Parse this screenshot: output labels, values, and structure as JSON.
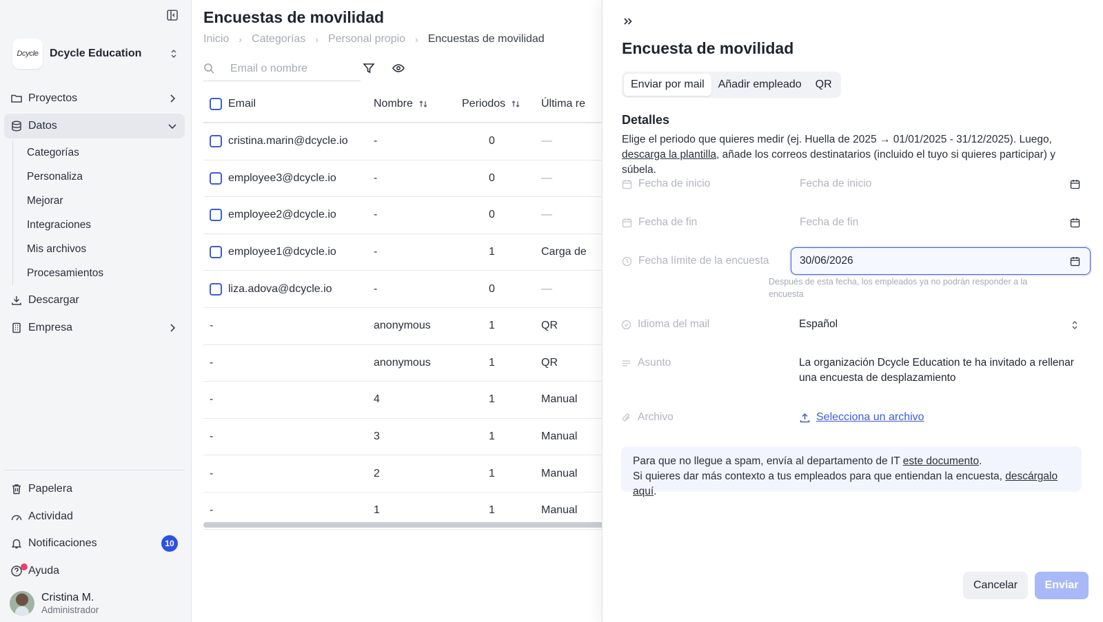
{
  "sidebar": {
    "org_logo": "Dcycle",
    "org_name": "Dcycle Education",
    "items": [
      {
        "label": "Proyectos"
      },
      {
        "label": "Datos"
      },
      {
        "label": "Descargar"
      },
      {
        "label": "Empresa"
      }
    ],
    "subitems": [
      {
        "label": "Categorías"
      },
      {
        "label": "Personaliza"
      },
      {
        "label": "Mejorar"
      },
      {
        "label": "Integraciones"
      },
      {
        "label": "Mis archivos"
      },
      {
        "label": "Procesamientos"
      }
    ],
    "bottom": [
      {
        "label": "Papelera"
      },
      {
        "label": "Actividad"
      },
      {
        "label": "Notificaciones"
      },
      {
        "label": "Ayuda"
      }
    ],
    "notifications_count": "10",
    "user": {
      "name": "Cristina M.",
      "role": "Administrador"
    }
  },
  "main": {
    "title": "Encuestas de movilidad",
    "breadcrumb": [
      "Inicio",
      "Categorías",
      "Personal propio",
      "Encuestas de movilidad"
    ],
    "search_placeholder": "Email o nombre",
    "columns": [
      "Email",
      "Nombre",
      "Periodos",
      "Última re"
    ],
    "rows": [
      {
        "email": "cristina.marin@dcycle.io",
        "name": "-",
        "periods": "0",
        "last": "—"
      },
      {
        "email": "employee3@dcycle.io",
        "name": "-",
        "periods": "0",
        "last": "—"
      },
      {
        "email": "employee2@dcycle.io",
        "name": "-",
        "periods": "0",
        "last": "—"
      },
      {
        "email": "employee1@dcycle.io",
        "name": "-",
        "periods": "1",
        "last": "Carga de"
      },
      {
        "email": "liza.adova@dcycle.io",
        "name": "-",
        "periods": "0",
        "last": "—"
      },
      {
        "email": "-",
        "name": "anonymous",
        "periods": "1",
        "last": "QR"
      },
      {
        "email": "-",
        "name": "anonymous",
        "periods": "1",
        "last": "QR"
      },
      {
        "email": "-",
        "name": "4",
        "periods": "1",
        "last": "Manual"
      },
      {
        "email": "-",
        "name": "3",
        "periods": "1",
        "last": "Manual"
      },
      {
        "email": "-",
        "name": "2",
        "periods": "1",
        "last": "Manual"
      },
      {
        "email": "-",
        "name": "1",
        "periods": "1",
        "last": "Manual"
      }
    ]
  },
  "panel": {
    "title": "Encuesta de movilidad",
    "tabs": [
      "Enviar por mail",
      "Añadir empleado",
      "QR"
    ],
    "details_heading": "Detalles",
    "details_text_1": "Elige el periodo que quieres medir (ej. Huella de 2025 → 01/01/2025 - 31/12/2025). Luego, ",
    "details_link": "descarga la plantilla",
    "details_text_2": ", añade los correos destinatarios (incluido el tuyo si quieres participar) y súbela.",
    "fields": {
      "start_label": "Fecha de inicio",
      "start_placeholder": "Fecha de inicio",
      "end_label": "Fecha de fin",
      "end_placeholder": "Fecha de fin",
      "deadline_label": "Fecha límite de la encuesta",
      "deadline_value": "30/06/2026",
      "deadline_hint": "Después de esta fecha, los empleados ya no podrán responder a la encuesta",
      "language_label": "Idioma del mail",
      "language_value": "Español",
      "subject_label": "Asunto",
      "subject_value": "La organización Dcycle Education te ha invitado a rellenar una encuesta de desplazamiento",
      "file_label": "Archivo",
      "file_link": "Selecciona un archivo"
    },
    "info": {
      "line1_text": "Para que no llegue a spam, envía al departamento de IT ",
      "line1_link": "este documento",
      "line1_end": ".",
      "line2_text": "Si quieres dar más contexto a tus empleados para que entiendan la encuesta, ",
      "line2_link": "descárgalo aquí",
      "line2_end": "."
    },
    "cancel_label": "Cancelar",
    "send_label": "Enviar"
  },
  "colors": {
    "accent": "#3b5bdb",
    "badge": "#2c52e3",
    "send_disabled": "#a9b8f6",
    "help_dot": "#e83f6f"
  }
}
